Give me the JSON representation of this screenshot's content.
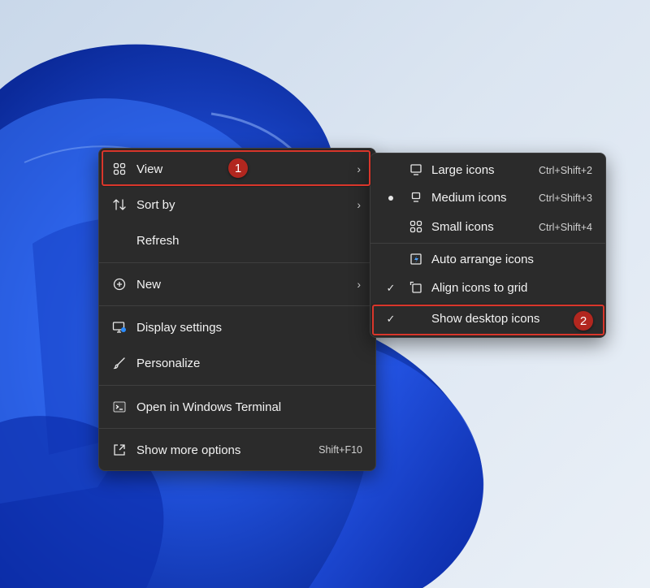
{
  "main_menu": {
    "view": "View",
    "sort_by": "Sort by",
    "refresh": "Refresh",
    "new": "New",
    "display_settings": "Display settings",
    "personalize": "Personalize",
    "open_terminal": "Open in Windows Terminal",
    "show_more": "Show more options",
    "show_more_shortcut": "Shift+F10"
  },
  "view_submenu": {
    "large_icons": "Large icons",
    "large_icons_shortcut": "Ctrl+Shift+2",
    "medium_icons": "Medium icons",
    "medium_icons_shortcut": "Ctrl+Shift+3",
    "small_icons": "Small icons",
    "small_icons_shortcut": "Ctrl+Shift+4",
    "auto_arrange": "Auto arrange icons",
    "align_to_grid": "Align icons to grid",
    "show_desktop_icons": "Show desktop icons"
  },
  "annotations": {
    "step1": "1",
    "step2": "2"
  },
  "colors": {
    "menu_bg": "#2b2b2b",
    "highlight_border": "#d9362b",
    "badge_bg": "#b2271f",
    "wallpaper_blue": "#1f4fd8"
  },
  "icons": {
    "view": "grid-icon",
    "sort_by": "sort-arrows-icon",
    "new": "plus-circle-icon",
    "display_settings": "monitor-gear-icon",
    "personalize": "brush-icon",
    "terminal": "terminal-icon",
    "show_more": "expand-icon"
  }
}
